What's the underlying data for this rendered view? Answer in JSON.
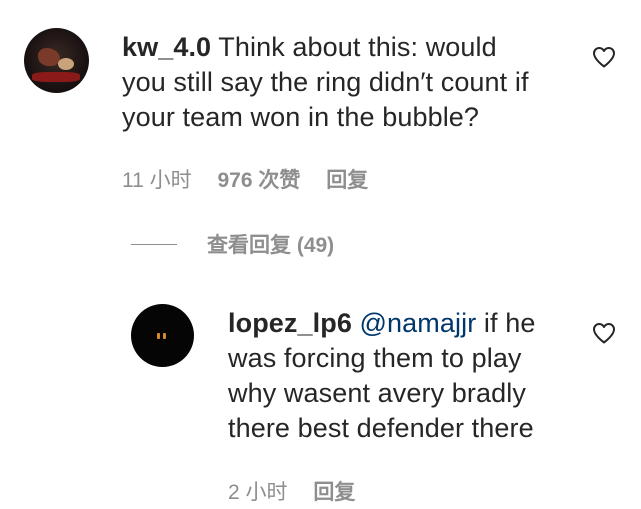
{
  "comments": [
    {
      "username": "kw_4.0",
      "lines": [
        "Think about this: would",
        "you still say the ring didn′t count if",
        "your team won in the bubble?"
      ],
      "time": "11 小时",
      "likes": "976 次赞",
      "reply_label": "回复",
      "avatar_icon": "profile-photo"
    }
  ],
  "view_replies": {
    "label": "查看回复 (49)"
  },
  "replies": [
    {
      "username": "lopez_lp6",
      "mention": "@namajjr",
      "lines": [
        "if he",
        "was forcing them to play",
        "why wasent avery bradly",
        "there best defender there"
      ],
      "time": "2 小时",
      "reply_label": "回复",
      "avatar_icon": "profile-photo"
    }
  ],
  "icons": {
    "like": "heart-outline-icon"
  },
  "colors": {
    "text": "#262626",
    "secondary": "#8e8e8e",
    "mention": "#00376b"
  }
}
